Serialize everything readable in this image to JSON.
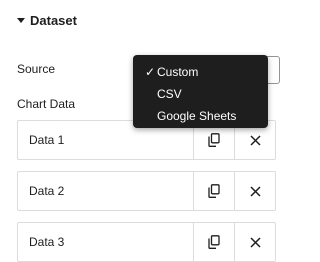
{
  "section": {
    "title": "Dataset"
  },
  "source": {
    "label": "Source",
    "options": [
      {
        "label": "Custom",
        "selected": true
      },
      {
        "label": "CSV",
        "selected": false
      },
      {
        "label": "Google Sheets",
        "selected": false
      }
    ],
    "check_glyph": "✓"
  },
  "chart_data": {
    "label": "Chart Data",
    "rows": [
      {
        "label": "Data 1"
      },
      {
        "label": "Data 2"
      },
      {
        "label": "Data 3"
      }
    ]
  },
  "icons": {
    "duplicate": "duplicate-icon",
    "remove": "close-icon",
    "collapse": "caret-down-icon"
  },
  "colors": {
    "dropdown_bg": "#1e1e1e",
    "text": "#1e1e1e",
    "border": "#dcdcde"
  }
}
